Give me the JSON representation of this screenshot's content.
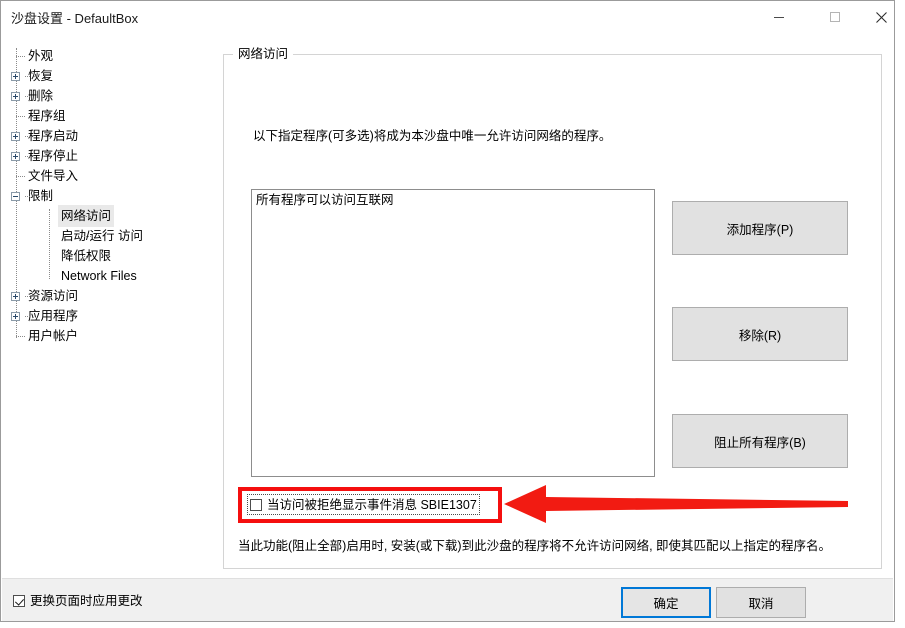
{
  "window": {
    "title": "沙盘设置 - DefaultBox",
    "controls": {
      "minimize": "minimize-icon",
      "maximize": "maximize-icon",
      "close": "close-icon"
    }
  },
  "sidebar": {
    "items": [
      {
        "label": "外观",
        "indent": 0,
        "expander": "none"
      },
      {
        "label": "恢复",
        "indent": 0,
        "expander": "plus"
      },
      {
        "label": "删除",
        "indent": 0,
        "expander": "plus"
      },
      {
        "label": "程序组",
        "indent": 0,
        "expander": "none"
      },
      {
        "label": "程序启动",
        "indent": 0,
        "expander": "plus"
      },
      {
        "label": "程序停止",
        "indent": 0,
        "expander": "plus"
      },
      {
        "label": "文件导入",
        "indent": 0,
        "expander": "none"
      },
      {
        "label": "限制",
        "indent": 0,
        "expander": "minus"
      },
      {
        "label": "网络访问",
        "indent": 1,
        "expander": "none",
        "selected": true
      },
      {
        "label": "启动/运行 访问",
        "indent": 1,
        "expander": "none"
      },
      {
        "label": "降低权限",
        "indent": 1,
        "expander": "none"
      },
      {
        "label": "Network Files",
        "indent": 1,
        "expander": "none"
      },
      {
        "label": "资源访问",
        "indent": 0,
        "expander": "plus"
      },
      {
        "label": "应用程序",
        "indent": 0,
        "expander": "plus"
      },
      {
        "label": "用户帐户",
        "indent": 0,
        "expander": "none"
      }
    ]
  },
  "panel": {
    "group_title": "网络访问",
    "description": "以下指定程序(可多选)将成为本沙盘中唯一允许访问网络的程序。",
    "program_list": [
      "所有程序可以访问互联网"
    ],
    "buttons": {
      "add": "添加程序(P)",
      "remove": "移除(R)",
      "block_all": "阻止所有程序(B)"
    },
    "notify_checkbox": {
      "label": "当访问被拒绝显示事件消息 SBIE1307",
      "checked": false
    },
    "note": "当此功能(阻止全部)启用时, 安装(或下载)到此沙盘的程序将不允许访问网络, 即使其匹配以上指定的程序名。"
  },
  "footer": {
    "apply_checkbox": {
      "label": "更换页面时应用更改",
      "checked": true
    },
    "ok": "确定",
    "cancel": "取消"
  },
  "annotation": {
    "color": "#f50f0f",
    "shape": "left-arrow",
    "highlight_target": "notify-checkbox"
  }
}
